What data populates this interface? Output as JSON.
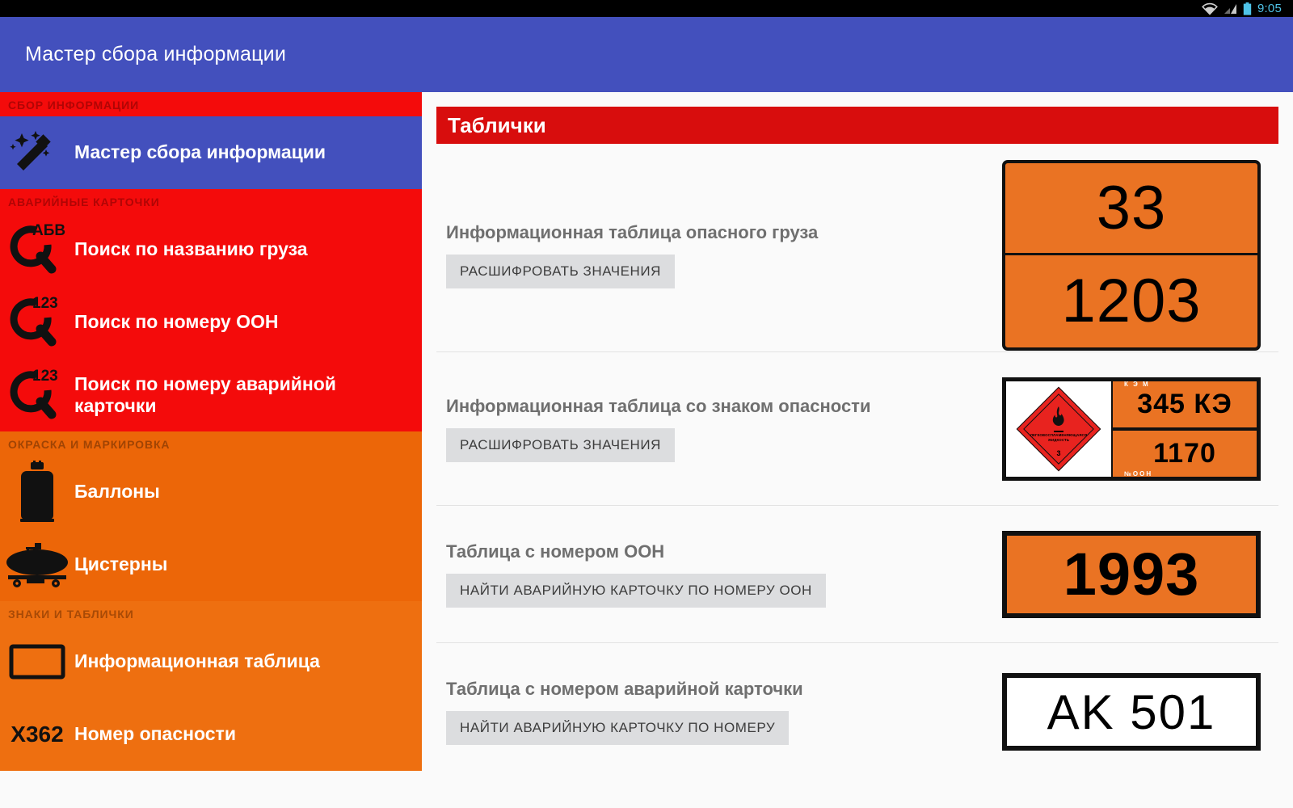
{
  "statusbar": {
    "time": "9:05",
    "icons": [
      "wifi-icon",
      "signal-icon",
      "battery-icon"
    ]
  },
  "actionbar": {
    "title": "Мастер сбора информации"
  },
  "sidebar": {
    "sections": [
      {
        "header": "СБОР ИНФОРМАЦИИ",
        "theme": "red",
        "items": [
          {
            "label": "Мастер сбора информации",
            "icon": "magic-wand-icon",
            "selected": true
          }
        ]
      },
      {
        "header": "АВАРИЙНЫЕ КАРТОЧКИ",
        "theme": "red",
        "items": [
          {
            "label": "Поиск по названию груза",
            "icon": "search-abv-icon",
            "badge": "АБВ",
            "selected": false
          },
          {
            "label": "Поиск по номеру ООН",
            "icon": "search-123-icon",
            "badge": "123",
            "selected": false
          },
          {
            "label": "Поиск по номеру аварийной карточки",
            "icon": "search-123-icon",
            "badge": "123",
            "selected": false
          }
        ]
      },
      {
        "header": "ОКРАСКА И МАРКИРОВКА",
        "theme": "orange",
        "items": [
          {
            "label": "Баллоны",
            "icon": "gas-cylinder-icon",
            "selected": false
          },
          {
            "label": "Цистерны",
            "icon": "tank-wagon-icon",
            "selected": false
          }
        ]
      },
      {
        "header": "ЗНАКИ И ТАБЛИЧКИ",
        "theme": "orange2",
        "items": [
          {
            "label": "Информационная таблица",
            "icon": "rectangle-plate-icon",
            "selected": false
          },
          {
            "label": "Номер опасности",
            "icon": "hazard-code-icon",
            "code": "X362",
            "selected": false
          }
        ]
      }
    ]
  },
  "content": {
    "banner_title": "Таблички",
    "rows": [
      {
        "title": "Информационная таблица опасного груза",
        "button": "РАСШИФРОВАТЬ ЗНАЧЕНИЯ",
        "plate": {
          "kind": "two-row-orange",
          "hazard_number": "33",
          "un_number": "1203"
        }
      },
      {
        "title": "Информационная таблица со знаком опасности",
        "button": "РАСШИФРОВАТЬ ЗНАЧЕНИЯ",
        "plate": {
          "kind": "combo-with-placard",
          "hazard_number": "345 КЭ",
          "un_number": "1170",
          "tag_top": "К Э М",
          "tag_bottom": "№ООН",
          "placard": {
            "class": "3",
            "text": "ЛЕГКОВОСПЛАМЕНЯЮЩАЯСЯ ЖИДКОСТЬ",
            "symbol": "flame-icon",
            "color": "#e8231f"
          }
        }
      },
      {
        "title": "Таблица с номером ООН",
        "button": "НАЙТИ АВАРИЙНУЮ КАРТОЧКУ ПО НОМЕРУ ООН",
        "plate": {
          "kind": "single-orange",
          "un_number": "1993"
        }
      },
      {
        "title": "Таблица с номером аварийной карточки",
        "button": "НАЙТИ АВАРИЙНУЮ КАРТОЧКУ ПО НОМЕРУ",
        "plate": {
          "kind": "single-white",
          "card_number": "AK 501"
        }
      }
    ]
  },
  "colors": {
    "accent_blue": "#4350bd",
    "red": "#f40b0b",
    "banner_red": "#d80d0d",
    "orange": "#ec6608",
    "plate_orange": "#ea7323",
    "status_time": "#4fc3e8"
  }
}
